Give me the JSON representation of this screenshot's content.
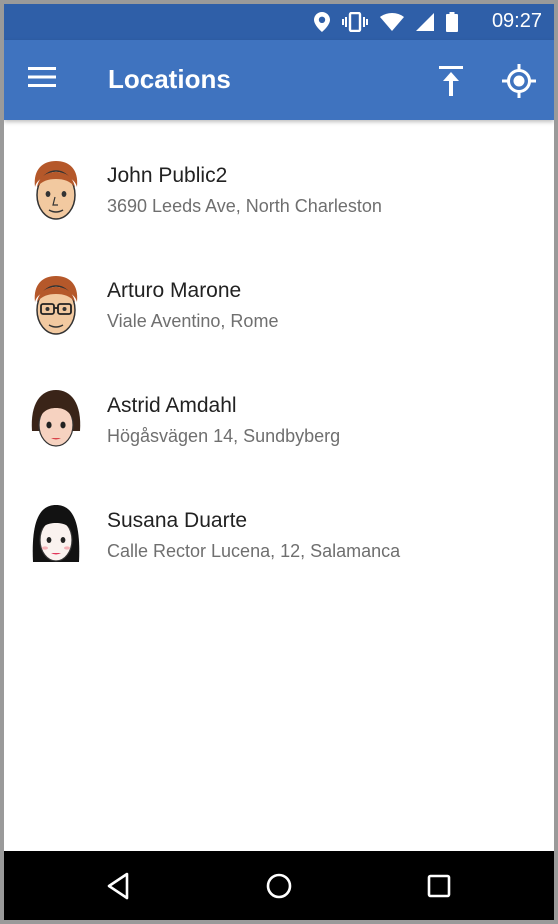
{
  "status_bar": {
    "time": "09:27",
    "icons": [
      "location-pin-icon",
      "vibrate-icon",
      "wifi-icon",
      "signal-icon",
      "battery-icon"
    ],
    "color": "#2f5fa8"
  },
  "app_bar": {
    "title": "Locations",
    "color": "#3f73bf",
    "menu_icon": "hamburger-menu-icon",
    "actions": [
      "upload-icon",
      "my-location-icon"
    ]
  },
  "locations": [
    {
      "name": "John Public2",
      "address": "3690 Leeds Ave, North Charleston",
      "avatar": "man-orange-hair"
    },
    {
      "name": "Arturo Marone",
      "address": "Viale Aventino, Rome",
      "avatar": "man-glasses"
    },
    {
      "name": "Astrid Amdahl",
      "address": "Högåsvägen 14, Sundbyberg",
      "avatar": "woman-brown-hair"
    },
    {
      "name": "Susana Duarte",
      "address": "Calle Rector Lucena, 12, Salamanca",
      "avatar": "woman-black-hair"
    }
  ],
  "nav_bar": {
    "buttons": [
      "back-icon",
      "home-icon",
      "recents-icon"
    ]
  }
}
